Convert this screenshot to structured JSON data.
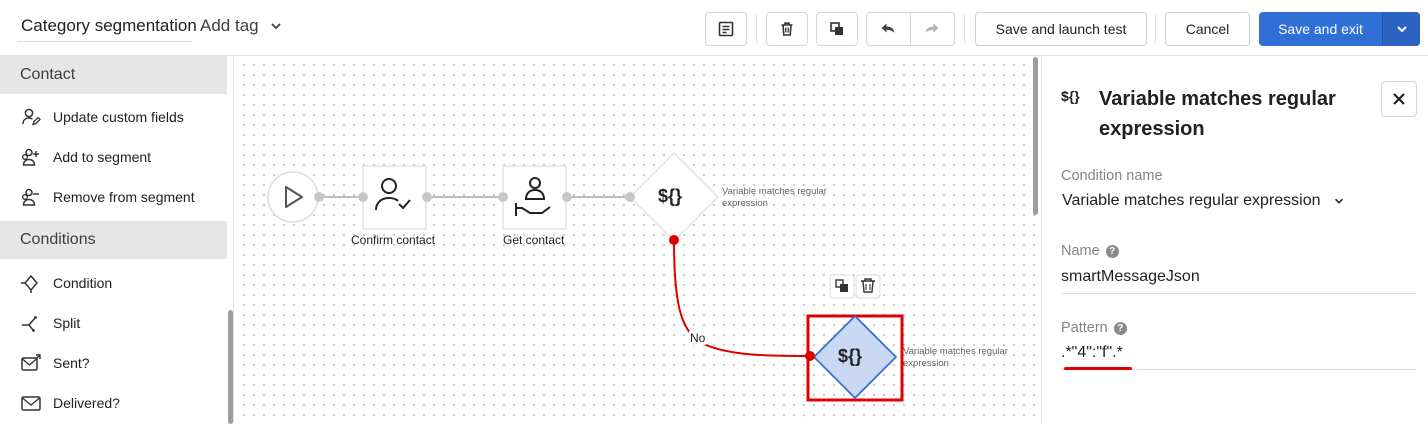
{
  "header": {
    "title": "Category segmentation",
    "tag_dropdown": "Add tag",
    "save_launch_label": "Save and launch test",
    "cancel_label": "Cancel",
    "save_exit_label": "Save and exit"
  },
  "sidebar": {
    "contact_section": "Contact",
    "contact_items": [
      {
        "label": "Update custom fields",
        "icon": "user-edit-icon"
      },
      {
        "label": "Add to segment",
        "icon": "group-add-icon"
      },
      {
        "label": "Remove from segment",
        "icon": "group-remove-icon"
      }
    ],
    "conditions_section": "Conditions",
    "condition_items": [
      {
        "label": "Condition",
        "icon": "condition-icon"
      },
      {
        "label": "Split",
        "icon": "split-icon"
      },
      {
        "label": "Sent?",
        "icon": "sent-icon"
      },
      {
        "label": "Delivered?",
        "icon": "delivered-icon"
      }
    ]
  },
  "canvas": {
    "nodes": {
      "confirm_contact": "Confirm contact",
      "get_contact": "Get contact",
      "variable_condition_symbol": "${}",
      "variable_condition_label": "Variable matches regular expression",
      "selected_condition_symbol": "${}",
      "selected_condition_label": "Variable matches regular expression"
    },
    "edge_no_label": "No"
  },
  "panel": {
    "icon_text": "${}",
    "title": "Variable matches regular expression",
    "condition_name_label": "Condition name",
    "condition_name_value": "Variable matches regular expression",
    "name_label": "Name",
    "name_value": "smartMessageJson",
    "pattern_label": "Pattern",
    "pattern_value": ".*\"4\":\"f\".*"
  },
  "colors": {
    "primary": "#2f6fd6",
    "highlight_red": "#e00000",
    "selected_node_fill": "#c9d8f2",
    "selected_node_border": "#3a6fd0"
  }
}
